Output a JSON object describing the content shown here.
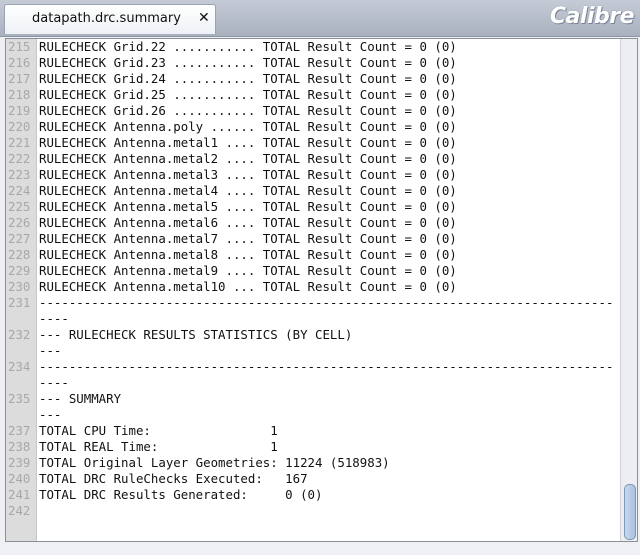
{
  "tab": {
    "label": "datapath.drc.summary",
    "close_glyph": "✕"
  },
  "brand": {
    "text": "Calibre"
  },
  "editor": {
    "lines": [
      {
        "num": "215",
        "text": "RULECHECK Grid.22 ........... TOTAL Result Count = 0 (0)"
      },
      {
        "num": "216",
        "text": "RULECHECK Grid.23 ........... TOTAL Result Count = 0 (0)"
      },
      {
        "num": "217",
        "text": "RULECHECK Grid.24 ........... TOTAL Result Count = 0 (0)"
      },
      {
        "num": "218",
        "text": "RULECHECK Grid.25 ........... TOTAL Result Count = 0 (0)"
      },
      {
        "num": "219",
        "text": "RULECHECK Grid.26 ........... TOTAL Result Count = 0 (0)"
      },
      {
        "num": "220",
        "text": "RULECHECK Antenna.poly ...... TOTAL Result Count = 0 (0)"
      },
      {
        "num": "221",
        "text": "RULECHECK Antenna.metal1 .... TOTAL Result Count = 0 (0)"
      },
      {
        "num": "222",
        "text": "RULECHECK Antenna.metal2 .... TOTAL Result Count = 0 (0)"
      },
      {
        "num": "223",
        "text": "RULECHECK Antenna.metal3 .... TOTAL Result Count = 0 (0)"
      },
      {
        "num": "224",
        "text": "RULECHECK Antenna.metal4 .... TOTAL Result Count = 0 (0)"
      },
      {
        "num": "225",
        "text": "RULECHECK Antenna.metal5 .... TOTAL Result Count = 0 (0)"
      },
      {
        "num": "226",
        "text": "RULECHECK Antenna.metal6 .... TOTAL Result Count = 0 (0)"
      },
      {
        "num": "227",
        "text": "RULECHECK Antenna.metal7 .... TOTAL Result Count = 0 (0)"
      },
      {
        "num": "228",
        "text": "RULECHECK Antenna.metal8 .... TOTAL Result Count = 0 (0)"
      },
      {
        "num": "229",
        "text": "RULECHECK Antenna.metal9 .... TOTAL Result Count = 0 (0)"
      },
      {
        "num": "230",
        "text": "RULECHECK Antenna.metal10 ... TOTAL Result Count = 0 (0)"
      },
      {
        "num": "231",
        "text": "---------------------------------------------------------------------------------",
        "wrap": true
      },
      {
        "num": "232",
        "text": "--- RULECHECK RESULTS STATISTICS (BY CELL)"
      },
      {
        "num": "",
        "text": "---"
      },
      {
        "num": "234",
        "text": "---------------------------------------------------------------------------------",
        "wrap": true
      },
      {
        "num": "235",
        "text": "--- SUMMARY"
      },
      {
        "num": "",
        "text": "---"
      },
      {
        "num": "237",
        "text": "TOTAL CPU Time:                1"
      },
      {
        "num": "238",
        "text": "TOTAL REAL Time:               1"
      },
      {
        "num": "239",
        "text": "TOTAL Original Layer Geometries: 11224 (518983)"
      },
      {
        "num": "240",
        "text": "TOTAL DRC RuleChecks Executed:   167"
      },
      {
        "num": "241",
        "text": "TOTAL DRC Results Generated:     0 (0)"
      },
      {
        "num": "242",
        "text": ""
      }
    ]
  }
}
